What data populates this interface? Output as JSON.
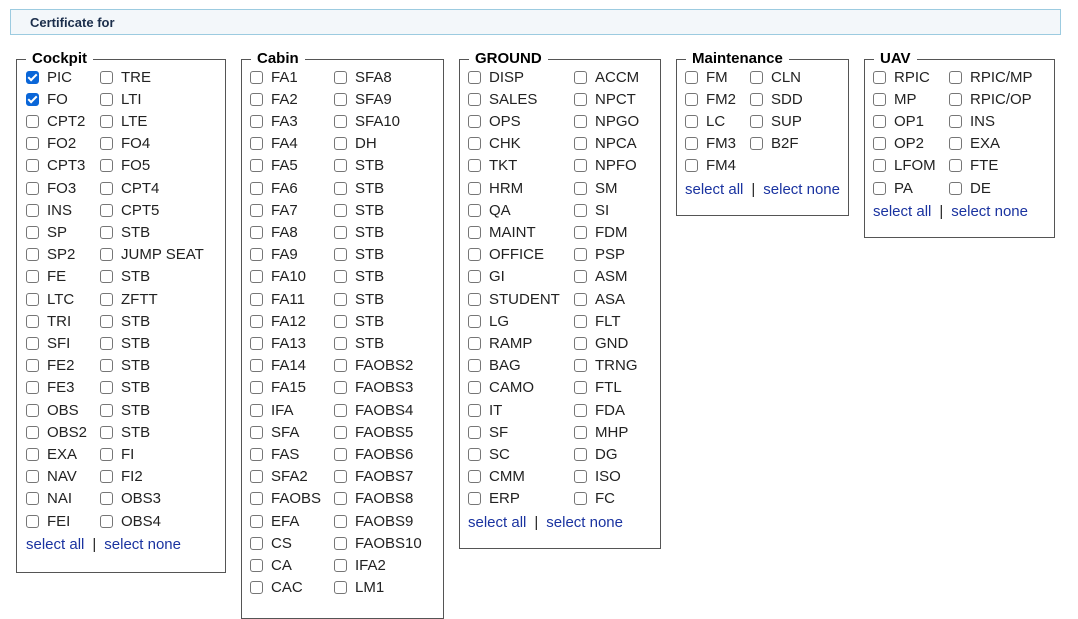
{
  "header": {
    "title": "Certificate for"
  },
  "select_all_label": "select all",
  "select_none_label": "select none",
  "separator": "|",
  "groups": [
    {
      "id": "cockpit",
      "title": "Cockpit",
      "col1": [
        {
          "label": "PIC",
          "checked": true
        },
        {
          "label": "FO",
          "checked": true
        },
        {
          "label": "CPT2",
          "checked": false
        },
        {
          "label": "FO2",
          "checked": false
        },
        {
          "label": "CPT3",
          "checked": false
        },
        {
          "label": "FO3",
          "checked": false
        },
        {
          "label": "INS",
          "checked": false
        },
        {
          "label": "SP",
          "checked": false
        },
        {
          "label": "SP2",
          "checked": false
        },
        {
          "label": "FE",
          "checked": false
        },
        {
          "label": "LTC",
          "checked": false
        },
        {
          "label": "TRI",
          "checked": false
        },
        {
          "label": "SFI",
          "checked": false
        },
        {
          "label": "FE2",
          "checked": false
        },
        {
          "label": "FE3",
          "checked": false
        },
        {
          "label": "OBS",
          "checked": false
        },
        {
          "label": "OBS2",
          "checked": false
        },
        {
          "label": "EXA",
          "checked": false
        },
        {
          "label": "NAV",
          "checked": false
        },
        {
          "label": "NAI",
          "checked": false
        },
        {
          "label": "FEI",
          "checked": false
        }
      ],
      "col2": [
        {
          "label": "TRE",
          "checked": false
        },
        {
          "label": "LTI",
          "checked": false
        },
        {
          "label": "LTE",
          "checked": false
        },
        {
          "label": "FO4",
          "checked": false
        },
        {
          "label": "FO5",
          "checked": false
        },
        {
          "label": "CPT4",
          "checked": false
        },
        {
          "label": "CPT5",
          "checked": false
        },
        {
          "label": "STB",
          "checked": false
        },
        {
          "label": "JUMP SEAT",
          "checked": false
        },
        {
          "label": "STB",
          "checked": false
        },
        {
          "label": "ZFTT",
          "checked": false
        },
        {
          "label": "STB",
          "checked": false
        },
        {
          "label": "STB",
          "checked": false
        },
        {
          "label": "STB",
          "checked": false
        },
        {
          "label": "STB",
          "checked": false
        },
        {
          "label": "STB",
          "checked": false
        },
        {
          "label": "STB",
          "checked": false
        },
        {
          "label": "FI",
          "checked": false
        },
        {
          "label": "FI2",
          "checked": false
        },
        {
          "label": "OBS3",
          "checked": false
        },
        {
          "label": "OBS4",
          "checked": false
        }
      ],
      "has_select": true
    },
    {
      "id": "cabin",
      "title": "Cabin",
      "col1": [
        {
          "label": "FA1",
          "checked": false
        },
        {
          "label": "FA2",
          "checked": false
        },
        {
          "label": "FA3",
          "checked": false
        },
        {
          "label": "FA4",
          "checked": false
        },
        {
          "label": "FA5",
          "checked": false
        },
        {
          "label": "FA6",
          "checked": false
        },
        {
          "label": "FA7",
          "checked": false
        },
        {
          "label": "FA8",
          "checked": false
        },
        {
          "label": "FA9",
          "checked": false
        },
        {
          "label": "FA10",
          "checked": false
        },
        {
          "label": "FA11",
          "checked": false
        },
        {
          "label": "FA12",
          "checked": false
        },
        {
          "label": "FA13",
          "checked": false
        },
        {
          "label": "FA14",
          "checked": false
        },
        {
          "label": "FA15",
          "checked": false
        },
        {
          "label": "IFA",
          "checked": false
        },
        {
          "label": "SFA",
          "checked": false
        },
        {
          "label": "FAS",
          "checked": false
        },
        {
          "label": "SFA2",
          "checked": false
        },
        {
          "label": "FAOBS",
          "checked": false
        },
        {
          "label": "EFA",
          "checked": false
        },
        {
          "label": "CS",
          "checked": false
        },
        {
          "label": "CA",
          "checked": false
        },
        {
          "label": "CAC",
          "checked": false
        }
      ],
      "col2": [
        {
          "label": "SFA8",
          "checked": false
        },
        {
          "label": "SFA9",
          "checked": false
        },
        {
          "label": "SFA10",
          "checked": false
        },
        {
          "label": "DH",
          "checked": false
        },
        {
          "label": "STB",
          "checked": false
        },
        {
          "label": "STB",
          "checked": false
        },
        {
          "label": "STB",
          "checked": false
        },
        {
          "label": "STB",
          "checked": false
        },
        {
          "label": "STB",
          "checked": false
        },
        {
          "label": "STB",
          "checked": false
        },
        {
          "label": "STB",
          "checked": false
        },
        {
          "label": "STB",
          "checked": false
        },
        {
          "label": "STB",
          "checked": false
        },
        {
          "label": "FAOBS2",
          "checked": false
        },
        {
          "label": "FAOBS3",
          "checked": false
        },
        {
          "label": "FAOBS4",
          "checked": false
        },
        {
          "label": "FAOBS5",
          "checked": false
        },
        {
          "label": "FAOBS6",
          "checked": false
        },
        {
          "label": "FAOBS7",
          "checked": false
        },
        {
          "label": "FAOBS8",
          "checked": false
        },
        {
          "label": "FAOBS9",
          "checked": false
        },
        {
          "label": "FAOBS10",
          "checked": false
        },
        {
          "label": "IFA2",
          "checked": false
        },
        {
          "label": "LM1",
          "checked": false
        }
      ],
      "has_select": false
    },
    {
      "id": "ground",
      "title": "GROUND",
      "col1": [
        {
          "label": "DISP",
          "checked": false
        },
        {
          "label": "SALES",
          "checked": false
        },
        {
          "label": "OPS",
          "checked": false
        },
        {
          "label": "CHK",
          "checked": false
        },
        {
          "label": "TKT",
          "checked": false
        },
        {
          "label": "HRM",
          "checked": false
        },
        {
          "label": "QA",
          "checked": false
        },
        {
          "label": "MAINT",
          "checked": false
        },
        {
          "label": "OFFICE",
          "checked": false
        },
        {
          "label": "GI",
          "checked": false
        },
        {
          "label": "STUDENT",
          "checked": false
        },
        {
          "label": "LG",
          "checked": false
        },
        {
          "label": "RAMP",
          "checked": false
        },
        {
          "label": "BAG",
          "checked": false
        },
        {
          "label": "CAMO",
          "checked": false
        },
        {
          "label": "IT",
          "checked": false
        },
        {
          "label": "SF",
          "checked": false
        },
        {
          "label": "SC",
          "checked": false
        },
        {
          "label": "CMM",
          "checked": false
        },
        {
          "label": "ERP",
          "checked": false
        }
      ],
      "col2": [
        {
          "label": "ACCM",
          "checked": false
        },
        {
          "label": "NPCT",
          "checked": false
        },
        {
          "label": "NPGO",
          "checked": false
        },
        {
          "label": "NPCA",
          "checked": false
        },
        {
          "label": "NPFO",
          "checked": false
        },
        {
          "label": "SM",
          "checked": false
        },
        {
          "label": "SI",
          "checked": false
        },
        {
          "label": "FDM",
          "checked": false
        },
        {
          "label": "PSP",
          "checked": false
        },
        {
          "label": "ASM",
          "checked": false
        },
        {
          "label": "ASA",
          "checked": false
        },
        {
          "label": "FLT",
          "checked": false
        },
        {
          "label": "GND",
          "checked": false
        },
        {
          "label": "TRNG",
          "checked": false
        },
        {
          "label": "FTL",
          "checked": false
        },
        {
          "label": "FDA",
          "checked": false
        },
        {
          "label": "MHP",
          "checked": false
        },
        {
          "label": "DG",
          "checked": false
        },
        {
          "label": "ISO",
          "checked": false
        },
        {
          "label": "FC",
          "checked": false
        }
      ],
      "has_select": true
    },
    {
      "id": "maintenance",
      "title": "Maintenance",
      "col1": [
        {
          "label": "FM",
          "checked": false
        },
        {
          "label": "FM2",
          "checked": false
        },
        {
          "label": "LC",
          "checked": false
        },
        {
          "label": "FM3",
          "checked": false
        },
        {
          "label": "FM4",
          "checked": false
        }
      ],
      "col2": [
        {
          "label": "CLN",
          "checked": false
        },
        {
          "label": "SDD",
          "checked": false
        },
        {
          "label": "SUP",
          "checked": false
        },
        {
          "label": "B2F",
          "checked": false
        }
      ],
      "has_select": true
    },
    {
      "id": "uav",
      "title": "UAV",
      "col1": [
        {
          "label": "RPIC",
          "checked": false
        },
        {
          "label": "MP",
          "checked": false
        },
        {
          "label": "OP1",
          "checked": false
        },
        {
          "label": "OP2",
          "checked": false
        },
        {
          "label": "LFOM",
          "checked": false
        },
        {
          "label": "PA",
          "checked": false
        }
      ],
      "col2": [
        {
          "label": "RPIC/MP",
          "checked": false
        },
        {
          "label": "RPIC/OP",
          "checked": false
        },
        {
          "label": "INS",
          "checked": false
        },
        {
          "label": "EXA",
          "checked": false
        },
        {
          "label": "FTE",
          "checked": false
        },
        {
          "label": "DE",
          "checked": false
        }
      ],
      "has_select": true
    }
  ]
}
